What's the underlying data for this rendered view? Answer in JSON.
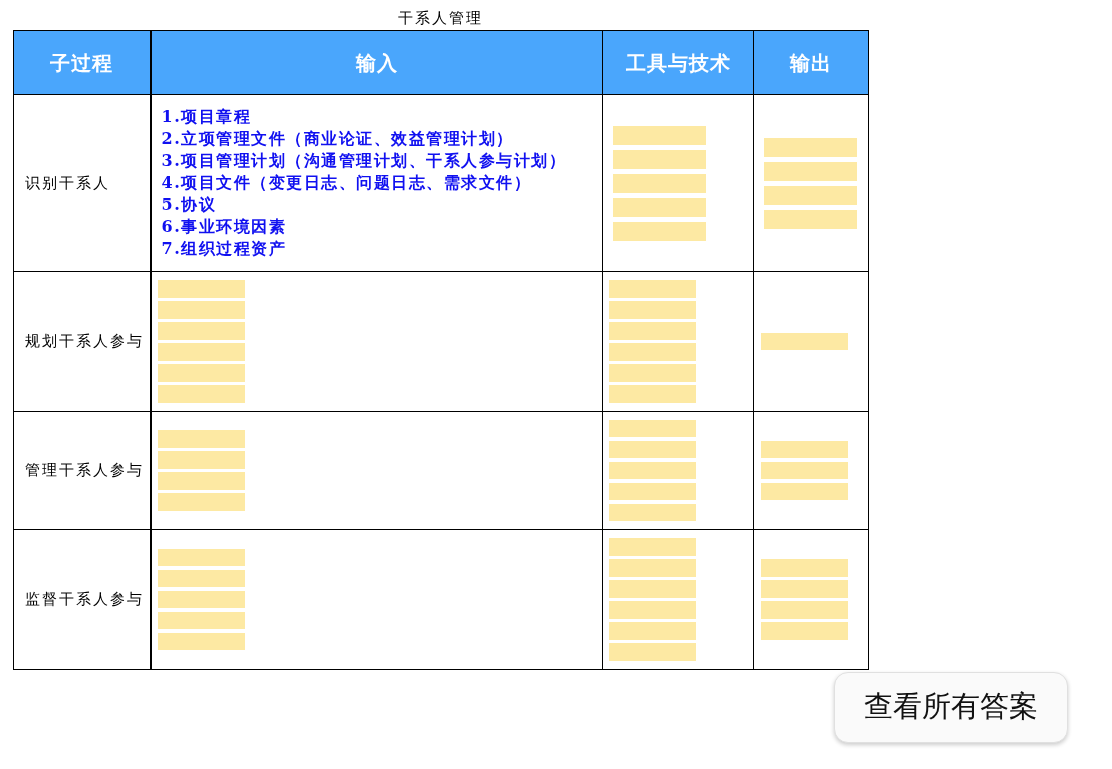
{
  "title": "干系人管理",
  "table": {
    "columns": [
      "子过程",
      "输入",
      "工具与技术",
      "输出"
    ],
    "rows": [
      {
        "process": "识别干系人",
        "inputs": {
          "kind": "list",
          "lines": [
            "1.项目章程",
            "2.立项管理文件（商业论证、效益管理计划）",
            "3.项目管理计划（沟通管理计划、干系人参与计划）",
            "4.项目文件（变更日志、问题日志、需求文件）",
            "5.协议",
            "6.事业环境因素",
            "7.组织过程资产"
          ]
        },
        "tools": {
          "kind": "blanks",
          "blanks": [
            {
              "covered": true
            },
            {
              "covered": true
            },
            {
              "covered": true
            },
            {
              "covered": true
            },
            {
              "covered": true
            }
          ]
        },
        "outputs": {
          "kind": "blanks",
          "blanks": [
            {
              "covered": true
            },
            {
              "covered": true
            },
            {
              "covered": true
            },
            {
              "covered": true
            }
          ]
        }
      },
      {
        "process": "规划干系人参与",
        "inputs": {
          "kind": "blanks",
          "blanks": [
            {
              "covered": true
            },
            {
              "covered": true
            },
            {
              "covered": true
            },
            {
              "covered": true
            },
            {
              "covered": true
            },
            {
              "covered": true
            }
          ]
        },
        "tools": {
          "kind": "blanks",
          "blanks": [
            {
              "covered": true
            },
            {
              "covered": true
            },
            {
              "covered": true
            },
            {
              "covered": true
            },
            {
              "covered": true
            },
            {
              "covered": true
            }
          ]
        },
        "outputs": {
          "kind": "blanks",
          "blanks": [
            {
              "covered": true
            }
          ]
        }
      },
      {
        "process": "管理干系人参与",
        "inputs": {
          "kind": "blanks",
          "blanks": [
            {
              "covered": true
            },
            {
              "covered": true
            },
            {
              "covered": true
            },
            {
              "covered": true
            }
          ]
        },
        "tools": {
          "kind": "blanks",
          "blanks": [
            {
              "covered": true
            },
            {
              "covered": true
            },
            {
              "covered": true
            },
            {
              "covered": true
            },
            {
              "covered": true
            }
          ]
        },
        "outputs": {
          "kind": "blanks",
          "blanks": [
            {
              "covered": true
            },
            {
              "covered": true
            },
            {
              "covered": true
            }
          ]
        }
      },
      {
        "process": "监督干系人参与",
        "inputs": {
          "kind": "blanks",
          "blanks": [
            {
              "covered": true
            },
            {
              "covered": true
            },
            {
              "covered": true
            },
            {
              "covered": true
            },
            {
              "covered": true
            }
          ]
        },
        "tools": {
          "kind": "blanks",
          "blanks": [
            {
              "covered": true
            },
            {
              "covered": true
            },
            {
              "covered": true
            },
            {
              "covered": true
            },
            {
              "covered": true
            },
            {
              "covered": true
            }
          ]
        },
        "outputs": {
          "kind": "blanks",
          "blanks": [
            {
              "covered": true
            },
            {
              "covered": true
            },
            {
              "covered": true
            },
            {
              "covered": true
            }
          ]
        }
      }
    ]
  },
  "button": "查看所有答案"
}
